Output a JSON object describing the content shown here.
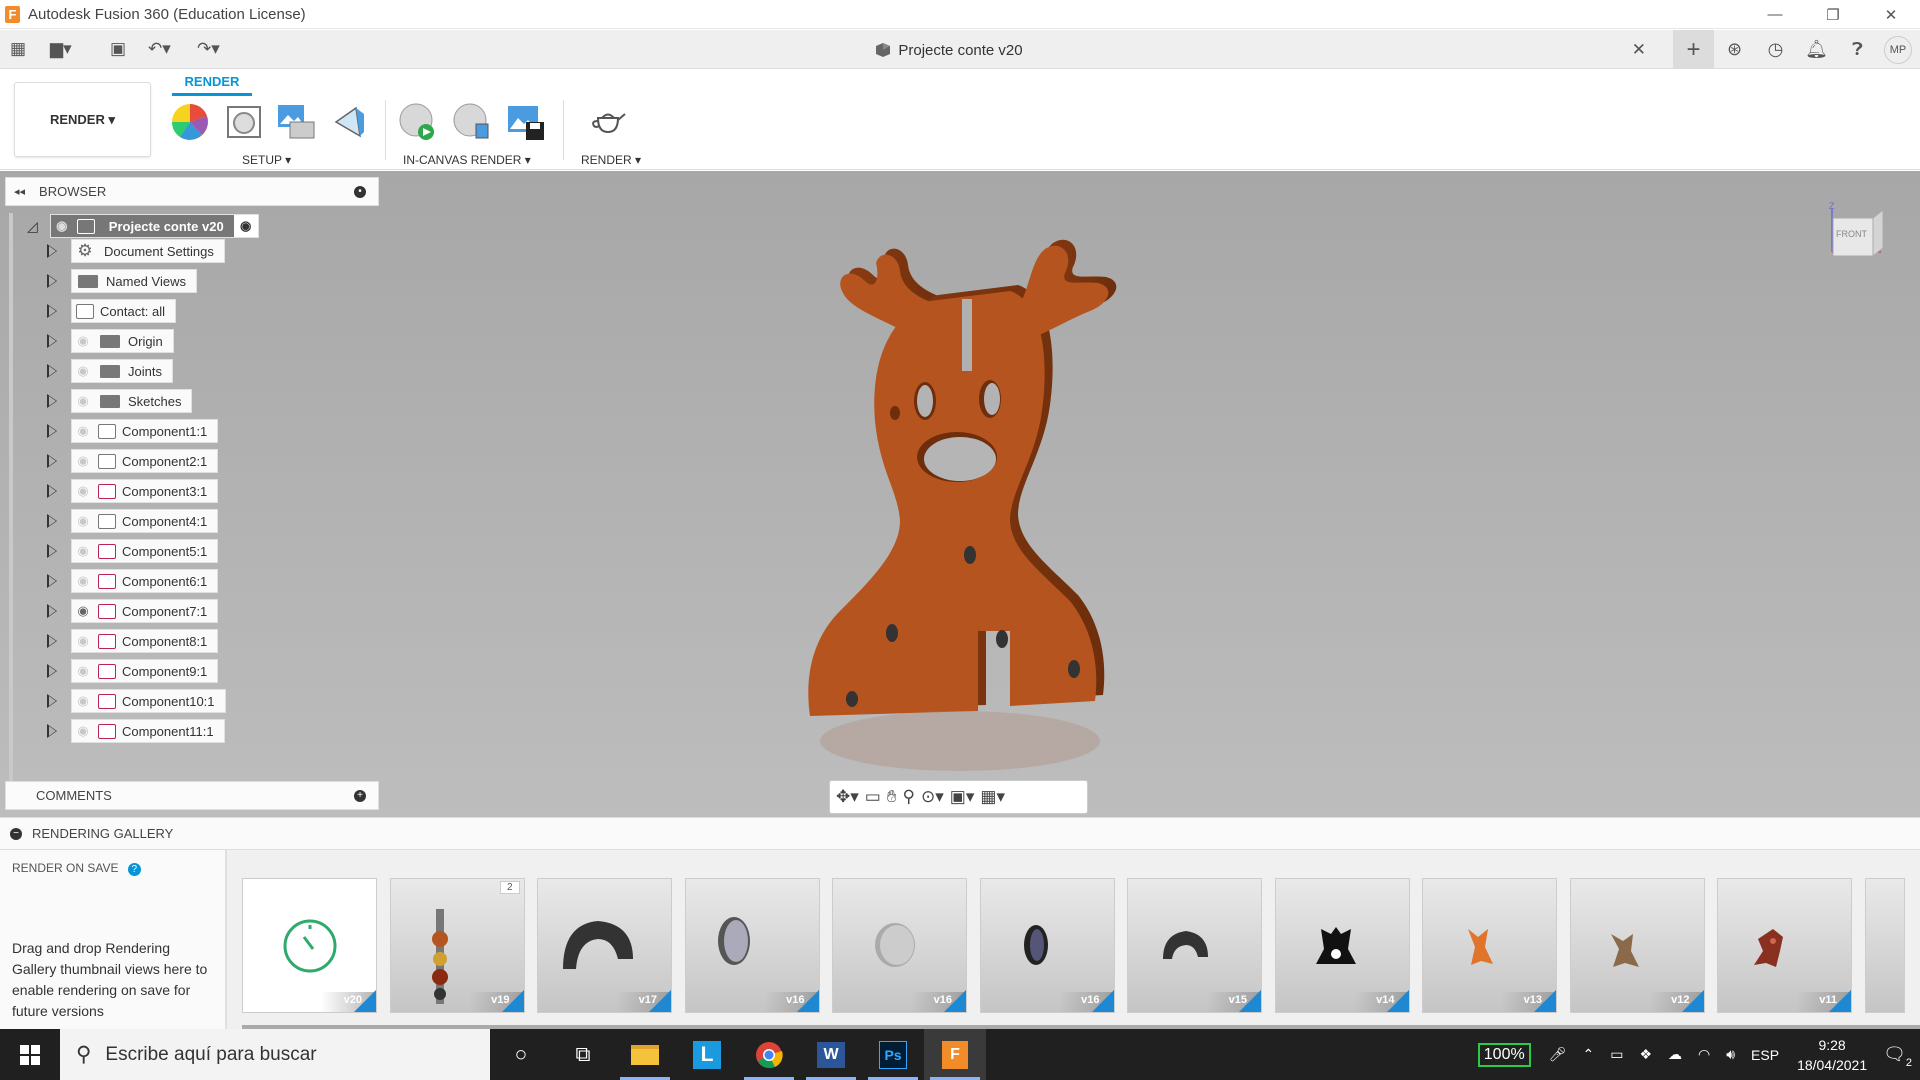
{
  "window": {
    "title": "Autodesk Fusion 360 (Education License)",
    "logo_letter": "F",
    "controls": [
      "—",
      "❐",
      "✕"
    ]
  },
  "document": {
    "title": "Projecte conte v20",
    "close": "✕"
  },
  "user": {
    "initials": "MP"
  },
  "ribbon": {
    "workspace": "RENDER ▾",
    "active_tab": "RENDER",
    "groups": {
      "setup": "SETUP ▾",
      "in_canvas": "IN-CANVAS RENDER ▾",
      "render": "RENDER ▾"
    }
  },
  "browser": {
    "title": "BROWSER",
    "root": "Projecte conte v20",
    "items": [
      {
        "label": "Document Settings",
        "icon": "gear-icon"
      },
      {
        "label": "Named Views",
        "icon": "folder-icon"
      },
      {
        "label": "Contact: all",
        "icon": "contact-icon"
      },
      {
        "label": "Origin",
        "icon": "folder-icon"
      },
      {
        "label": "Joints",
        "icon": "folder-icon"
      },
      {
        "label": "Sketches",
        "icon": "folder-icon"
      },
      {
        "label": "Component1:1",
        "icon": "component-icon"
      },
      {
        "label": "Component2:1",
        "icon": "component-icon"
      },
      {
        "label": "Component3:1",
        "icon": "component-icon"
      },
      {
        "label": "Component4:1",
        "icon": "component-icon"
      },
      {
        "label": "Component5:1",
        "icon": "component-icon"
      },
      {
        "label": "Component6:1",
        "icon": "component-icon"
      },
      {
        "label": "Component7:1",
        "icon": "component-icon"
      },
      {
        "label": "Component8:1",
        "icon": "component-icon"
      },
      {
        "label": "Component9:1",
        "icon": "component-icon"
      },
      {
        "label": "Component10:1",
        "icon": "component-icon"
      },
      {
        "label": "Component11:1",
        "icon": "component-icon"
      }
    ]
  },
  "comments": {
    "title": "COMMENTS"
  },
  "viewcube": {
    "face": "FRONT",
    "axis_z": "Z"
  },
  "gallery": {
    "title": "RENDERING GALLERY",
    "render_on_save": "RENDER ON SAVE",
    "help": "?",
    "description": "Drag and drop Rendering Gallery thumbnail views here to enable rendering on save for future versions",
    "stack_badge": "2",
    "thumbnails": [
      {
        "version": "v20",
        "subject": "in-progress"
      },
      {
        "version": "v19",
        "subject": "stack"
      },
      {
        "version": "v17",
        "subject": "dark-arch"
      },
      {
        "version": "v16",
        "subject": "mirror-disc"
      },
      {
        "version": "v16",
        "subject": "light-disc"
      },
      {
        "version": "v16",
        "subject": "dark-disc"
      },
      {
        "version": "v15",
        "subject": "small-arch"
      },
      {
        "version": "v14",
        "subject": "black-figure"
      },
      {
        "version": "v13",
        "subject": "orange-deer"
      },
      {
        "version": "v12",
        "subject": "brown-deer"
      },
      {
        "version": "v11",
        "subject": "red-deer"
      }
    ]
  },
  "taskbar": {
    "search_placeholder": "Escribe aquí para buscar",
    "battery": "100%",
    "language": "ESP",
    "time": "9:28",
    "date": "18/04/2021",
    "notifications": "2"
  },
  "colors": {
    "accent": "#0696d7",
    "model": "#b5541f",
    "canvas": "#b0b0b0",
    "battery_green": "#2cc94d"
  }
}
